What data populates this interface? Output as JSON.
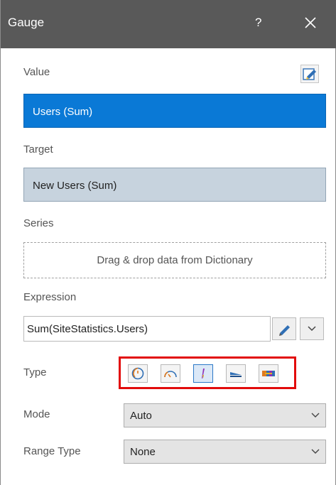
{
  "titlebar": {
    "title": "Gauge",
    "help": "?"
  },
  "value": {
    "label": "Value",
    "field": "Users (Sum)"
  },
  "target": {
    "label": "Target",
    "field": "New Users (Sum)"
  },
  "series": {
    "label": "Series",
    "dropzone": "Drag & drop data from Dictionary"
  },
  "expression": {
    "label": "Expression",
    "value": "Sum(SiteStatistics.Users)"
  },
  "type": {
    "label": "Type",
    "buttons": [
      {
        "icon": "full-circular-gauge-icon",
        "selected": false
      },
      {
        "icon": "half-circular-gauge-icon",
        "selected": false
      },
      {
        "icon": "bullet-gauge-icon",
        "selected": true
      },
      {
        "icon": "horizontal-linear-gauge-icon",
        "selected": false
      },
      {
        "icon": "horizontal-bar-gauge-icon",
        "selected": false
      }
    ]
  },
  "mode": {
    "label": "Mode",
    "value": "Auto"
  },
  "range_type": {
    "label": "Range Type",
    "value": "None"
  },
  "colors": {
    "title_bg": "#595959",
    "selected_field": "#0a79d6",
    "target_field": "#c7d3de",
    "highlight": "#e20b0b"
  }
}
